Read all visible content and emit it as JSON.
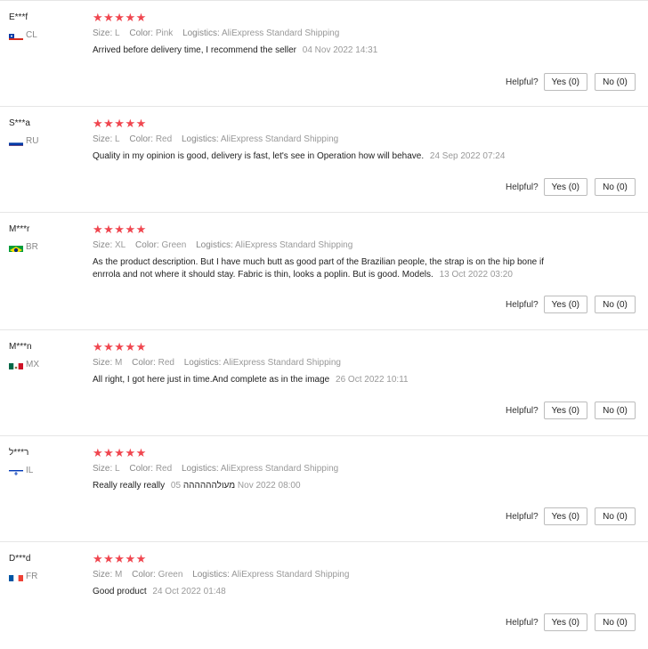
{
  "reviews": [
    {
      "user": "E***f",
      "country": "CL",
      "stars": "★★★★★",
      "size_label": "Size:",
      "size": "L",
      "color_label": "Color:",
      "color": "Pink",
      "logistics_label": "Logistics:",
      "logistics": "AliExpress Standard Shipping",
      "text": "Arrived before delivery time, I recommend the seller",
      "date": "04 Nov 2022 14:31",
      "helpful_label": "Helpful?",
      "yes": "Yes (0)",
      "no": "No (0)"
    },
    {
      "user": "S***a",
      "country": "RU",
      "stars": "★★★★★",
      "size_label": "Size:",
      "size": "L",
      "color_label": "Color:",
      "color": "Red",
      "logistics_label": "Logistics:",
      "logistics": "AliExpress Standard Shipping",
      "text": "Quality in my opinion is good, delivery is fast, let's see in Operation how will behave.",
      "date": "24 Sep 2022 07:24",
      "helpful_label": "Helpful?",
      "yes": "Yes (0)",
      "no": "No (0)"
    },
    {
      "user": "M***r",
      "country": "BR",
      "stars": "★★★★★",
      "size_label": "Size:",
      "size": "XL",
      "color_label": "Color:",
      "color": "Green",
      "logistics_label": "Logistics:",
      "logistics": "AliExpress Standard Shipping",
      "text": "As the product description. But I have much butt as good part of the Brazilian people, the strap is on the hip bone if enrrola and not where it should stay. Fabric is thin, looks a poplin. But is good. Models.",
      "date": "13 Oct 2022 03:20",
      "helpful_label": "Helpful?",
      "yes": "Yes (0)",
      "no": "No (0)"
    },
    {
      "user": "M***n",
      "country": "MX",
      "stars": "★★★★★",
      "size_label": "Size:",
      "size": "M",
      "color_label": "Color:",
      "color": "Red",
      "logistics_label": "Logistics:",
      "logistics": "AliExpress Standard Shipping",
      "text": "All right, I got here just in time.And complete as in the image",
      "date": "26 Oct 2022 10:11",
      "helpful_label": "Helpful?",
      "yes": "Yes (0)",
      "no": "No (0)"
    },
    {
      "user": "ר***ל",
      "country": "IL",
      "stars": "★★★★★",
      "size_label": "Size:",
      "size": "L",
      "color_label": "Color:",
      "color": "Red",
      "logistics_label": "Logistics:",
      "logistics": "AliExpress Standard Shipping",
      "text": "Really really really מעולהההההה",
      "date": "05 Nov 2022 08:00",
      "helpful_label": "Helpful?",
      "yes": "Yes (0)",
      "no": "No (0)"
    },
    {
      "user": "D***d",
      "country": "FR",
      "stars": "★★★★★",
      "size_label": "Size:",
      "size": "M",
      "color_label": "Color:",
      "color": "Green",
      "logistics_label": "Logistics:",
      "logistics": "AliExpress Standard Shipping",
      "text": "Good product",
      "date": "24 Oct 2022 01:48",
      "helpful_label": "Helpful?",
      "yes": "Yes (0)",
      "no": "No (0)"
    }
  ],
  "colors": {
    "star": "#f0464f",
    "border": "#e6e6e6",
    "muted": "#999999"
  }
}
